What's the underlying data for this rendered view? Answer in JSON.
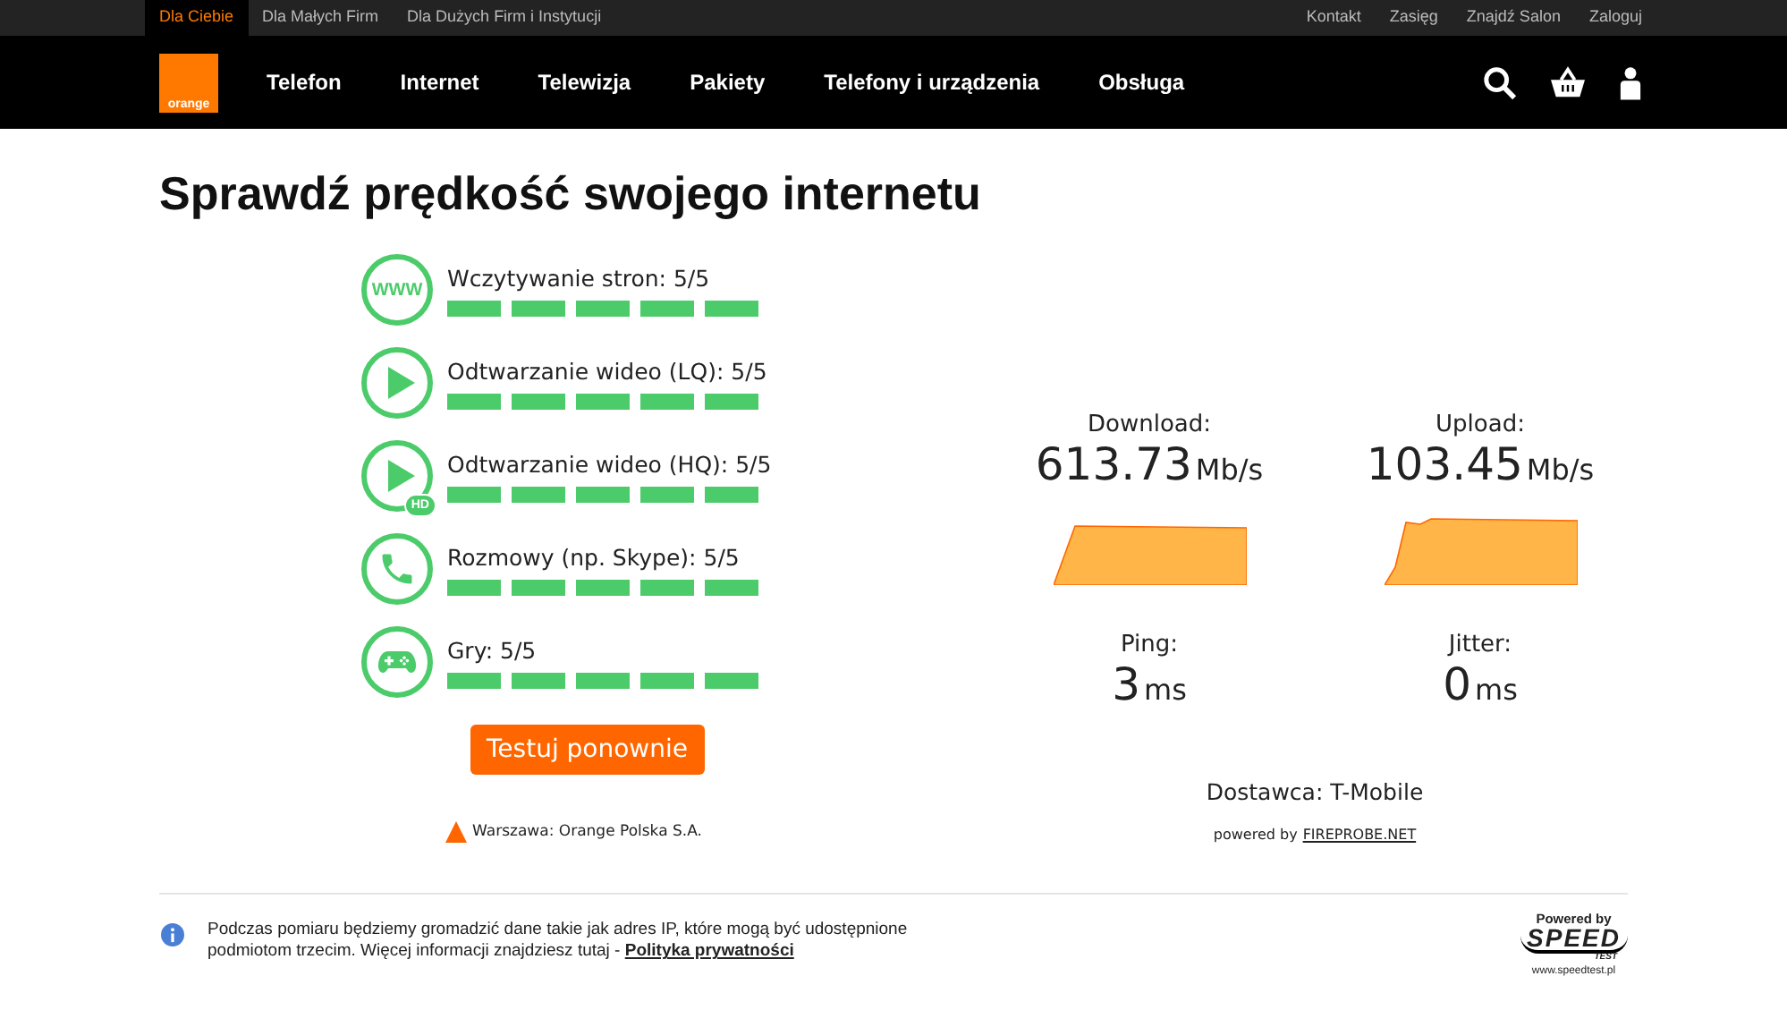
{
  "top_bar": {
    "segments": [
      {
        "label": "Dla Ciebie",
        "selected": true
      },
      {
        "label": "Dla Małych Firm",
        "selected": false
      },
      {
        "label": "Dla Dużych Firm i Instytucji",
        "selected": false
      }
    ],
    "links": [
      "Kontakt",
      "Zasięg",
      "Znajdź Salon",
      "Zaloguj"
    ]
  },
  "nav": {
    "logo": "orange",
    "items": [
      "Telefon",
      "Internet",
      "Telewizja",
      "Pakiety",
      "Telefony i urządzenia",
      "Obsługa"
    ]
  },
  "title": "Sprawdź prędkość swojego internetu",
  "ratings": [
    {
      "kind": "www",
      "icon_text": "WWW",
      "label": "Wczytywanie stron: 5/5",
      "stars": 5
    },
    {
      "kind": "play",
      "label": "Odtwarzanie wideo (LQ): 5/5",
      "stars": 5
    },
    {
      "kind": "play_hd",
      "icon_text": "HD",
      "label": "Odtwarzanie wideo (HQ): 5/5",
      "stars": 5
    },
    {
      "kind": "phone",
      "label": "Rozmowy (np. Skype): 5/5",
      "stars": 5
    },
    {
      "kind": "gamepad",
      "label": "Gry: 5/5",
      "stars": 5
    }
  ],
  "retest_button": "Testuj ponownie",
  "server": "Warszawa: Orange Polska S.A.",
  "results": [
    {
      "kind": "graph",
      "label": "Download:",
      "value": "613.73",
      "unit": "Mb/s"
    },
    {
      "kind": "graph",
      "label": "Upload:",
      "value": "103.45",
      "unit": "Mb/s"
    },
    {
      "kind": "plain",
      "label": "Ping:",
      "value": "3",
      "unit": "ms"
    },
    {
      "kind": "plain",
      "label": "Jitter:",
      "value": "0",
      "unit": "ms"
    }
  ],
  "provider": "Dostawca: T-Mobile",
  "powered_by": {
    "text": "powered by",
    "link": "FIREPROBE.NET"
  },
  "footer": {
    "notice": "Podczas pomiaru będziemy gromadzić dane takie jak adres IP, które mogą być udostępnione podmiotom trzecim. Więcej informacji znajdziesz tutaj -",
    "link": "Polityka prywatności",
    "logo": {
      "top": "Powered by",
      "name": "SPEED",
      "sub": "TEST",
      "url": "www.speedtest.pl"
    }
  }
}
